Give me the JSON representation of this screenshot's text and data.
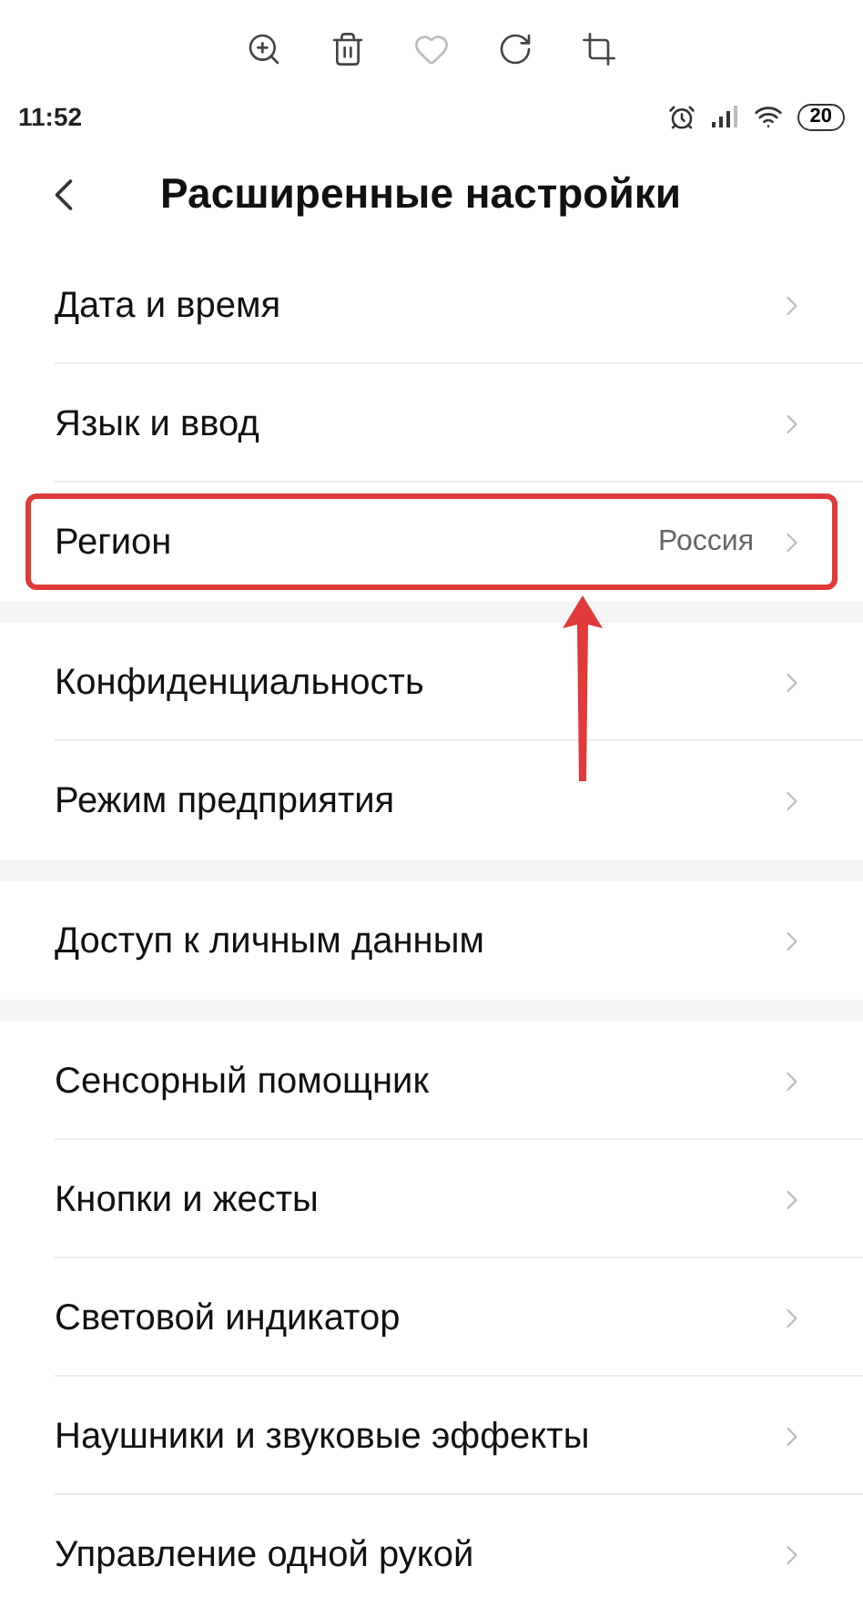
{
  "toolbar": {
    "icons": [
      {
        "kind": "zoom"
      },
      {
        "kind": "delete"
      },
      {
        "kind": "favorite"
      },
      {
        "kind": "rotate"
      },
      {
        "kind": "crop"
      }
    ]
  },
  "status_bar": {
    "time": "11:52",
    "battery": "20"
  },
  "header": {
    "title": "Расширенные настройки"
  },
  "groups": [
    {
      "items": [
        {
          "label": "Дата и время",
          "highlighted": false
        },
        {
          "label": "Язык и ввод",
          "highlighted": false
        },
        {
          "label": "Регион",
          "value": "Россия",
          "highlighted": true
        }
      ]
    },
    {
      "items": [
        {
          "label": "Конфиденциальность",
          "highlighted": false
        },
        {
          "label": "Режим предприятия",
          "highlighted": false
        }
      ]
    },
    {
      "items": [
        {
          "label": "Доступ к личным данным",
          "highlighted": false
        }
      ]
    },
    {
      "items": [
        {
          "label": "Сенсорный помощник",
          "highlighted": false
        },
        {
          "label": "Кнопки и жесты",
          "highlighted": false
        },
        {
          "label": "Световой индикатор",
          "highlighted": false
        },
        {
          "label": "Наушники и звуковые эффекты",
          "highlighted": false
        },
        {
          "label": "Управление одной рукой",
          "highlighted": false
        }
      ]
    }
  ]
}
